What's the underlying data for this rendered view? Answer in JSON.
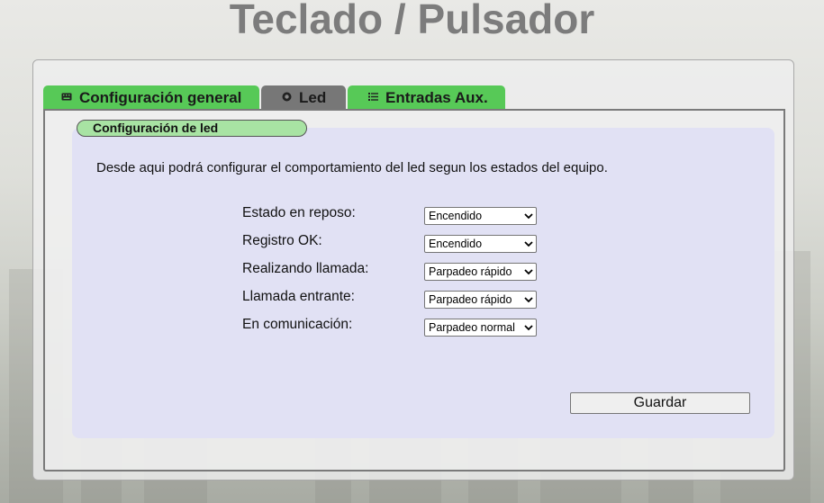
{
  "page": {
    "title": "Teclado / Pulsador"
  },
  "tabs": [
    {
      "label": "Configuración general",
      "icon": "keyboard-icon",
      "active": false
    },
    {
      "label": "Led",
      "icon": "led-icon",
      "active": true
    },
    {
      "label": "Entradas Aux.",
      "icon": "list-icon",
      "active": false
    }
  ],
  "section": {
    "title": "Configuración de led",
    "description": "Desde aqui podrá configurar el comportamiento del led segun los estados del equipo."
  },
  "fields": [
    {
      "label": "Estado en reposo:",
      "value": "Encendido"
    },
    {
      "label": "Registro OK:",
      "value": "Encendido"
    },
    {
      "label": "Realizando llamada:",
      "value": "Parpadeo rápido"
    },
    {
      "label": "Llamada entrante:",
      "value": "Parpadeo rápido"
    },
    {
      "label": "En comunicación:",
      "value": "Parpadeo normal"
    }
  ],
  "actions": {
    "save_label": "Guardar"
  },
  "colors": {
    "tab_inactive": "#57c957",
    "tab_active": "#777777",
    "section_label_bg": "#a8e3a3",
    "inner_box_bg": "#dedef6",
    "title_color": "#7c7c7c"
  }
}
